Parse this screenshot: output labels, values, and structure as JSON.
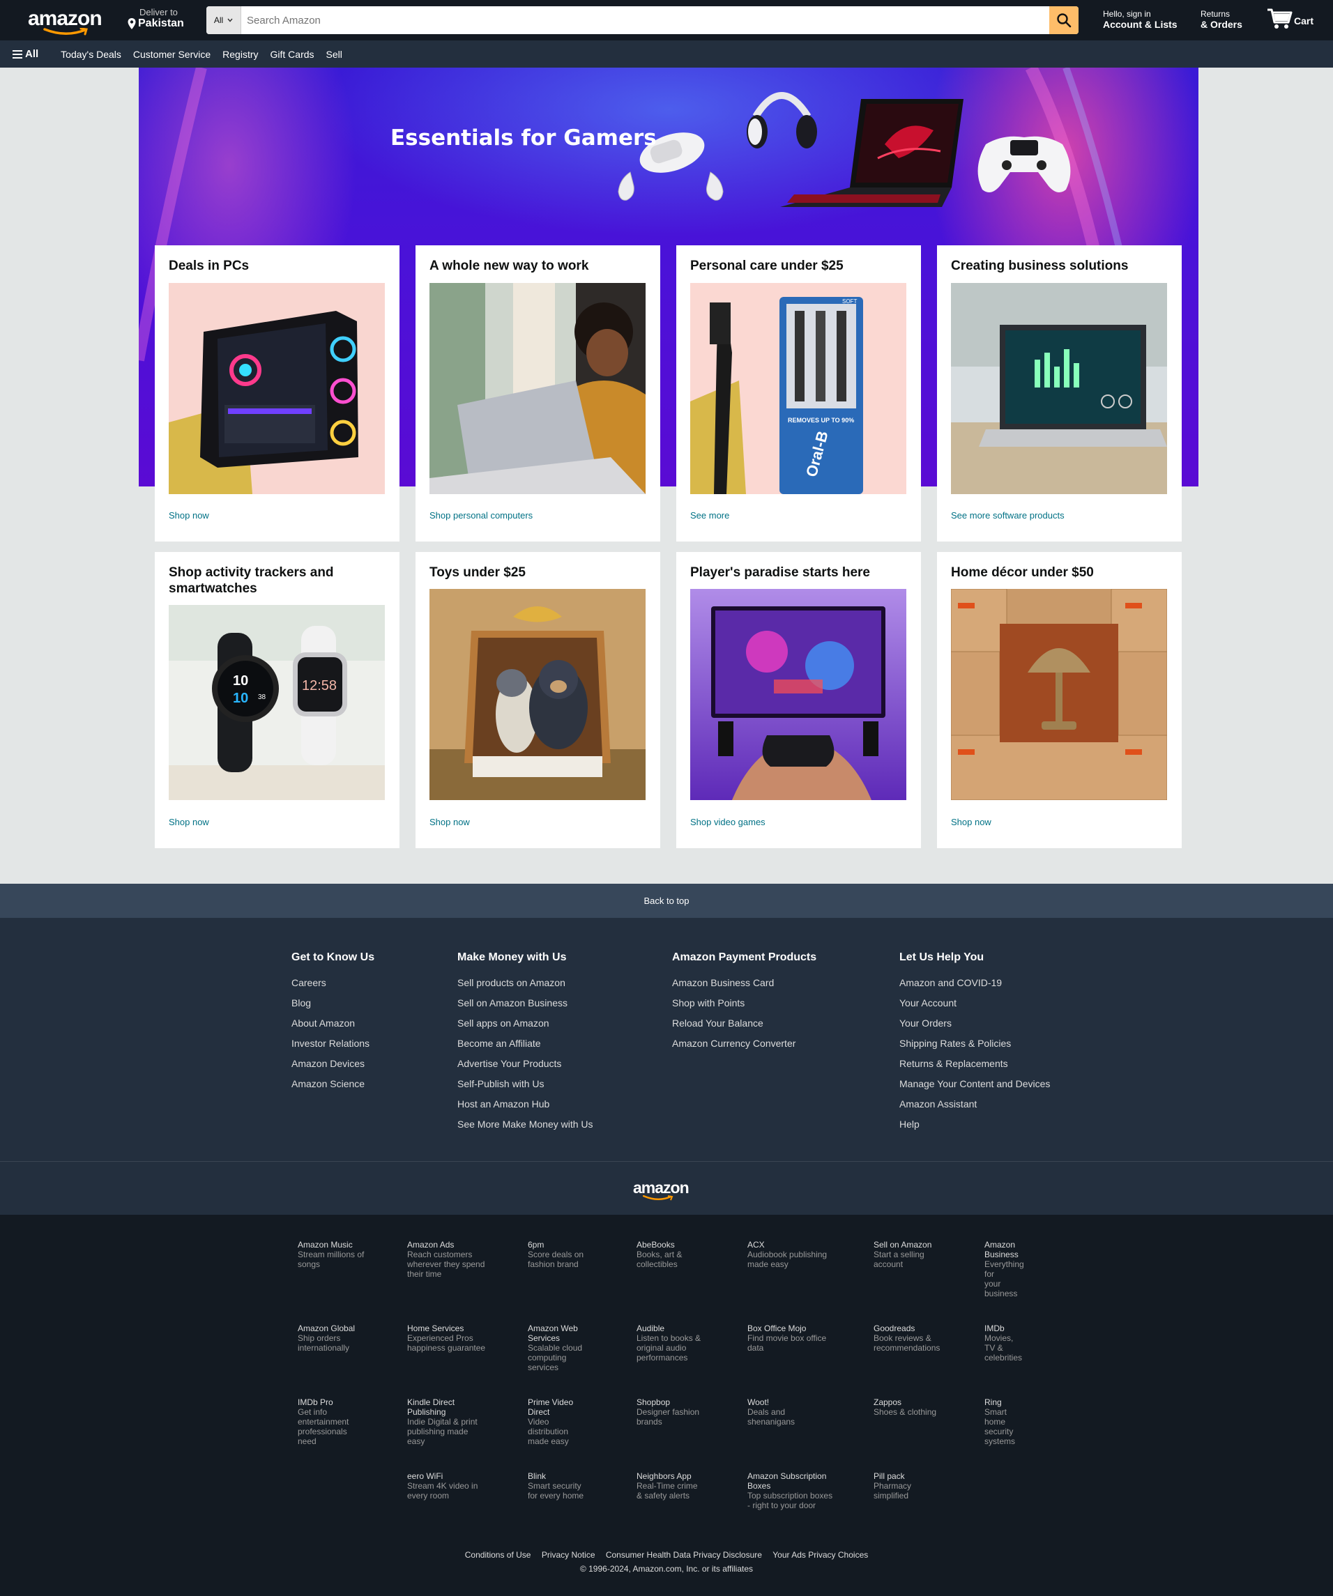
{
  "header": {
    "logo_text": "amazon",
    "deliver_label": "Deliver to",
    "deliver_location": "Pakistan",
    "search_category": "All",
    "search_placeholder": "Search Amazon",
    "account_line1": "Hello, sign in",
    "account_line2": "Account & Lists",
    "returns_line1": "Returns",
    "returns_line2": "& Orders",
    "cart_label": "Cart"
  },
  "subnav": {
    "all_label": "All",
    "items": [
      "Today's Deals",
      "Customer Service",
      "Registry",
      "Gift Cards",
      "Sell"
    ]
  },
  "hero": {
    "title": "Essentials for Gamers"
  },
  "cards": [
    {
      "title": "Deals in PCs",
      "link": "Shop now",
      "image": "gaming-pc"
    },
    {
      "title": "A whole new way to work",
      "link": "Shop personal computers",
      "image": "woman-laptop"
    },
    {
      "title": "Personal care under $25",
      "link": "See more",
      "image": "toothbrush"
    },
    {
      "title": "Creating business solutions",
      "link": "See more software products",
      "image": "laptop-dashboard"
    },
    {
      "title": "Shop activity trackers and smartwatches",
      "link": "Shop now",
      "image": "smartwatches"
    },
    {
      "title": "Toys under $25",
      "link": "Shop now",
      "image": "plush-toys"
    },
    {
      "title": "Player's paradise starts here",
      "link": "Shop video games",
      "image": "video-game"
    },
    {
      "title": "Home décor under $50",
      "link": "Shop now",
      "image": "lamp-boxes"
    }
  ],
  "watch_display": {
    "black": "10",
    "black_small": "10",
    "black_sec": "38",
    "white": "12:58"
  },
  "toothbrush_text": {
    "brand": "Oral-B",
    "claim": "REMOVES UP TO 90%",
    "soft": "SOFT"
  },
  "back_to_top": "Back to top",
  "footer": {
    "columns": [
      {
        "title": "Get to Know Us",
        "links": [
          "Careers",
          "Blog",
          "About Amazon",
          "Investor Relations",
          "Amazon Devices",
          "Amazon Science"
        ]
      },
      {
        "title": "Make Money with Us",
        "links": [
          "Sell products on Amazon",
          "Sell on Amazon Business",
          "Sell apps on Amazon",
          "Become an Affiliate",
          "Advertise Your Products",
          "Self-Publish with Us",
          "Host an Amazon Hub",
          "See More Make Money with Us"
        ]
      },
      {
        "title": "Amazon Payment Products",
        "links": [
          "Amazon Business Card",
          "Shop with Points",
          "Reload Your Balance",
          "Amazon Currency Converter"
        ]
      },
      {
        "title": "Let Us Help You",
        "links": [
          "Amazon and COVID-19",
          "Your Account",
          "Your Orders",
          "Shipping Rates & Policies",
          "Returns & Replacements",
          "Manage Your Content and Devices",
          "Amazon Assistant",
          "Help"
        ]
      }
    ],
    "logo_text": "amazon"
  },
  "services": [
    [
      {
        "title": "Amazon Music",
        "desc": "Stream millions of songs"
      },
      {
        "title": "Amazon Ads",
        "desc": "Reach customers wherever they spend their time"
      },
      {
        "title": "6pm",
        "desc": "Score deals on fashion brand"
      },
      {
        "title": "AbeBooks",
        "desc": "Books, art & collectibles"
      },
      {
        "title": "ACX",
        "desc": "Audiobook publishing made easy"
      },
      {
        "title": "Sell on Amazon",
        "desc": "Start a selling account"
      },
      {
        "title": "Amazon Business",
        "desc": "Everything for your business"
      }
    ],
    [
      {
        "title": "Amazon Global",
        "desc": "Ship orders internationally"
      },
      {
        "title": "Home Services",
        "desc": "Experienced Pros happiness guarantee"
      },
      {
        "title": "Amazon Web Services",
        "desc": "Scalable cloud computing services"
      },
      {
        "title": "Audible",
        "desc": "Listen to books & original audio performances"
      },
      {
        "title": "Box Office Mojo",
        "desc": "Find movie box office data"
      },
      {
        "title": "Goodreads",
        "desc": "Book reviews & recommendations"
      },
      {
        "title": "IMDb",
        "desc": "Movies, TV & celebrities"
      }
    ],
    [
      {
        "title": "IMDb Pro",
        "desc": "Get info entertainment professionals need"
      },
      {
        "title": "Kindle Direct Publishing",
        "desc": "Indie Digital & print publishing made easy"
      },
      {
        "title": "Prime Video Direct",
        "desc": "Video distribution made easy"
      },
      {
        "title": "Shopbop",
        "desc": "Designer fashion brands"
      },
      {
        "title": "Woot!",
        "desc": "Deals and shenanigans"
      },
      {
        "title": "Zappos",
        "desc": "Shoes & clothing"
      },
      {
        "title": "Ring",
        "desc": "Smart home security systems"
      }
    ],
    [
      {
        "title": "",
        "desc": ""
      },
      {
        "title": "eero WiFi",
        "desc": "Stream 4K video in every room"
      },
      {
        "title": "Blink",
        "desc": "Smart security for every home"
      },
      {
        "title": "Neighbors App",
        "desc": "Real-Time crime & safety alerts"
      },
      {
        "title": "Amazon Subscription Boxes",
        "desc": "Top subscription boxes - right to your door"
      },
      {
        "title": "Pill pack",
        "desc": "Pharmacy simplified"
      },
      {
        "title": "",
        "desc": ""
      }
    ]
  ],
  "legal": {
    "links": [
      "Conditions of Use",
      "Privacy Notice",
      "Consumer Health Data Privacy Disclosure",
      "Your Ads Privacy Choices"
    ],
    "copyright": "© 1996-2024, Amazon.com, Inc. or its affiliates"
  }
}
